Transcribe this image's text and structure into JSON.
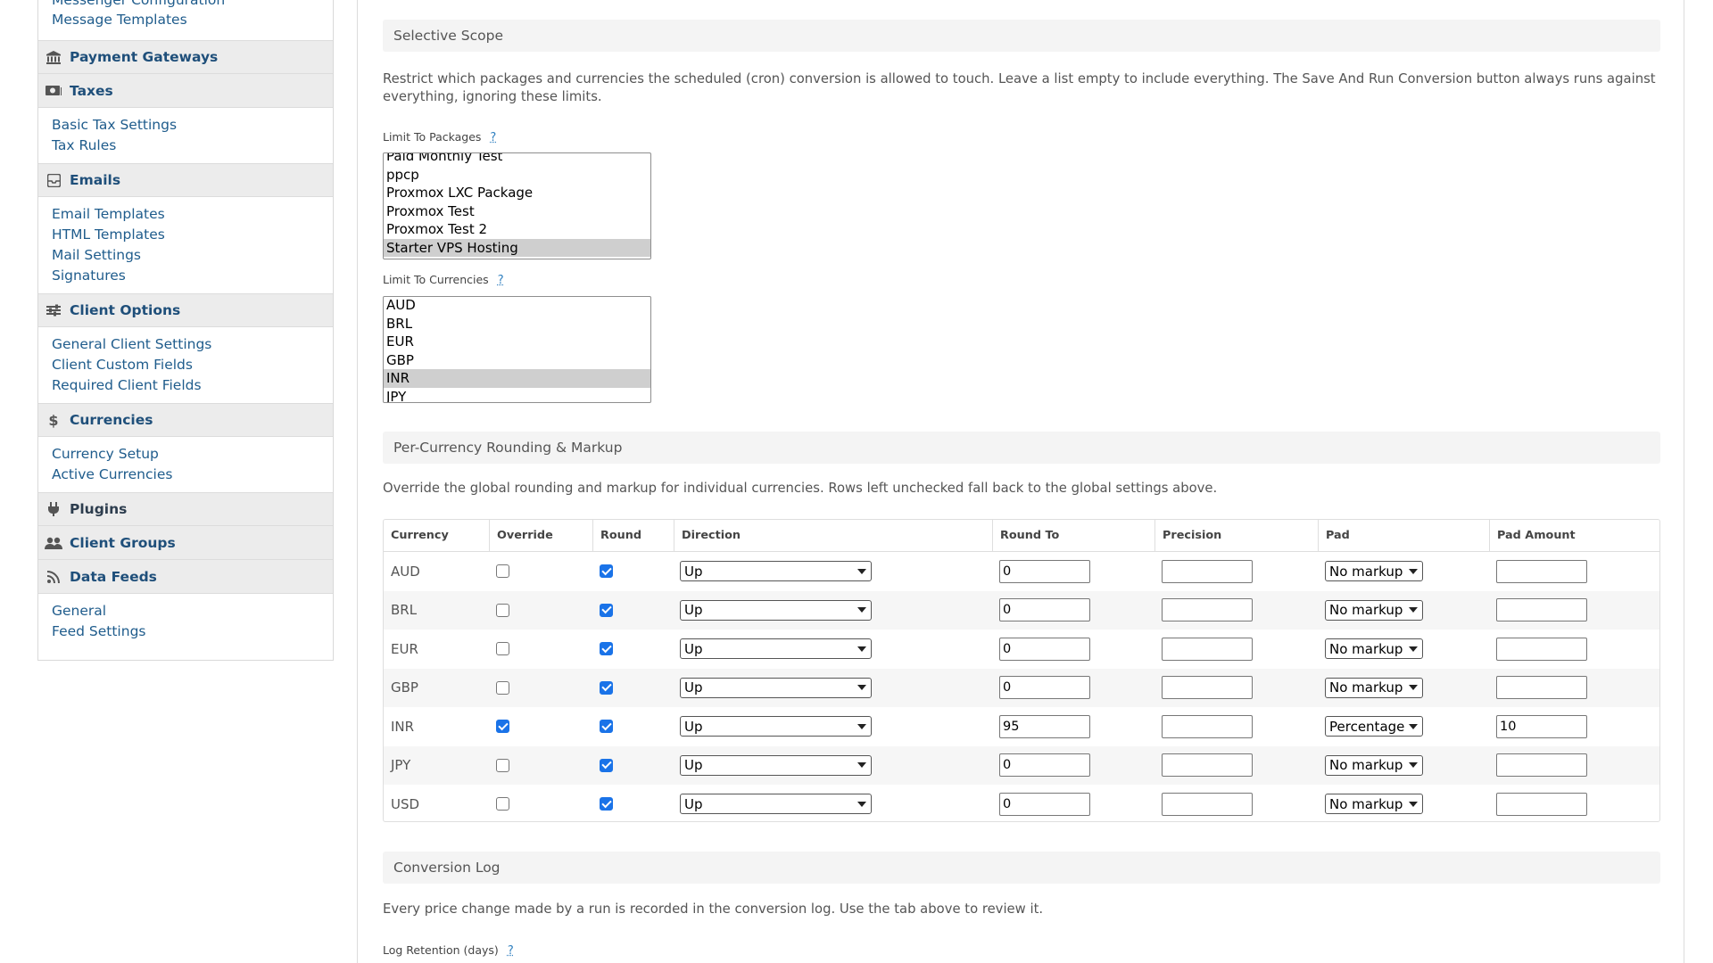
{
  "sidebar": {
    "top_links": [
      "Messenger Configuration",
      "Message Templates"
    ],
    "payment_gateways": "Payment Gateways",
    "taxes": {
      "title": "Taxes",
      "links": [
        "Basic Tax Settings",
        "Tax Rules"
      ]
    },
    "emails": {
      "title": "Emails",
      "links": [
        "Email Templates",
        "HTML Templates",
        "Mail Settings",
        "Signatures"
      ]
    },
    "client_options": {
      "title": "Client Options",
      "links": [
        "General Client Settings",
        "Client Custom Fields",
        "Required Client Fields"
      ]
    },
    "currencies": {
      "title": "Currencies",
      "links": [
        "Currency Setup",
        "Active Currencies"
      ]
    },
    "plugins": "Plugins",
    "client_groups": "Client Groups",
    "data_feeds": {
      "title": "Data Feeds",
      "links": [
        "General",
        "Feed Settings"
      ]
    }
  },
  "selective_scope": {
    "title": "Selective Scope",
    "description": "Restrict which packages and currencies the scheduled (cron) conversion is allowed to touch. Leave a list empty to include everything. The Save And Run Conversion button always runs against everything, ignoring these limits.",
    "packages_label": "Limit To Packages",
    "help": "?",
    "packages": [
      "Paid Monthly Test",
      "ppcp",
      "Proxmox LXC Package",
      "Proxmox Test",
      "Proxmox Test 2",
      "Starter VPS Hosting"
    ],
    "packages_selected": "Starter VPS Hosting",
    "currencies_label": "Limit To Currencies",
    "currencies": [
      "AUD",
      "BRL",
      "EUR",
      "GBP",
      "INR",
      "JPY"
    ],
    "currencies_selected": "INR"
  },
  "rounding": {
    "title": "Per-Currency Rounding & Markup",
    "description": "Override the global rounding and markup for individual currencies. Rows left unchecked fall back to the global settings above.",
    "headers": [
      "Currency",
      "Override",
      "Round",
      "Direction",
      "Round To",
      "Precision",
      "Pad",
      "Pad Amount"
    ],
    "rows": [
      {
        "currency": "AUD",
        "override": false,
        "round": true,
        "direction": "Up",
        "round_to": "0",
        "precision": "",
        "pad": "No markup",
        "pad_amount": ""
      },
      {
        "currency": "BRL",
        "override": false,
        "round": true,
        "direction": "Up",
        "round_to": "0",
        "precision": "",
        "pad": "No markup",
        "pad_amount": ""
      },
      {
        "currency": "EUR",
        "override": false,
        "round": true,
        "direction": "Up",
        "round_to": "0",
        "precision": "",
        "pad": "No markup",
        "pad_amount": ""
      },
      {
        "currency": "GBP",
        "override": false,
        "round": true,
        "direction": "Up",
        "round_to": "0",
        "precision": "",
        "pad": "No markup",
        "pad_amount": ""
      },
      {
        "currency": "INR",
        "override": true,
        "round": true,
        "direction": "Up",
        "round_to": "95",
        "precision": "",
        "pad": "Percentage",
        "pad_amount": "10"
      },
      {
        "currency": "JPY",
        "override": false,
        "round": true,
        "direction": "Up",
        "round_to": "0",
        "precision": "",
        "pad": "No markup",
        "pad_amount": ""
      },
      {
        "currency": "USD",
        "override": false,
        "round": true,
        "direction": "Up",
        "round_to": "0",
        "precision": "",
        "pad": "No markup",
        "pad_amount": ""
      }
    ]
  },
  "conversion_log": {
    "title": "Conversion Log",
    "description": "Every price change made by a run is recorded in the conversion log. Use the tab above to review it.",
    "retention_label": "Log Retention (days)",
    "help": "?"
  }
}
